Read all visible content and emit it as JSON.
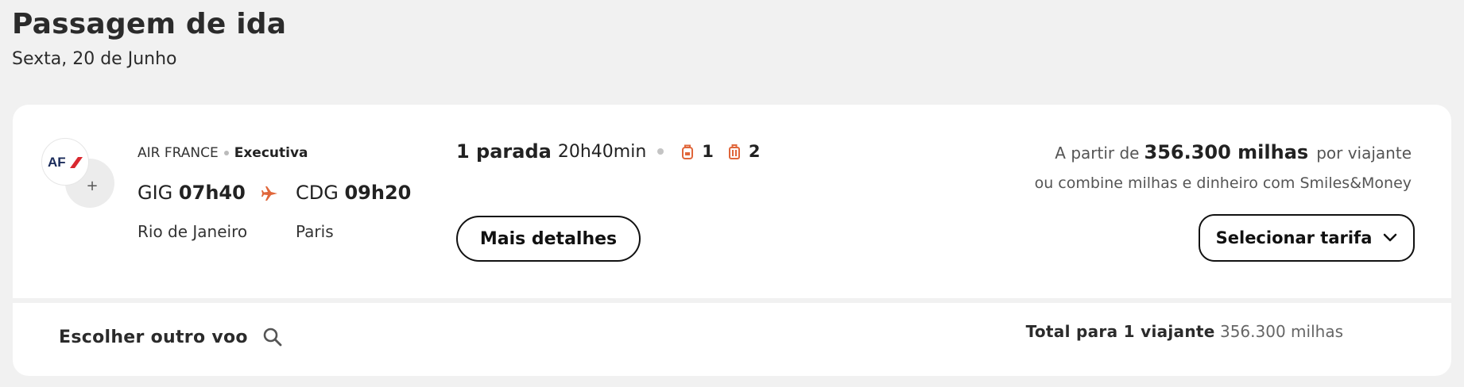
{
  "header": {
    "title": "Passagem de ida",
    "date": "Sexta, 20 de Junho"
  },
  "flight": {
    "airline": "AIR FRANCE",
    "cabin": "Executiva",
    "logo_text": "AF",
    "more_symbol": "+",
    "origin_code": "GIG",
    "departure_time": "07h40",
    "origin_city": "Rio de Janeiro",
    "destination_code": "CDG",
    "arrival_time": "09h20",
    "destination_city": "Paris",
    "stops": "1 parada",
    "duration": "20h40min",
    "carry_on_count": "1",
    "checked_bag_count": "2",
    "details_button": "Mais detalhes"
  },
  "price": {
    "prefix": "A partir de",
    "miles": "356.300 milhas",
    "suffix": "por viajante",
    "combine_text": "ou combine milhas e dinheiro com Smiles&Money",
    "select_button": "Selecionar tarifa"
  },
  "footer": {
    "other_flight_label": "Escolher outro voo",
    "total_label": "Total para 1 viajante",
    "total_value": "356.300 milhas"
  },
  "colors": {
    "accent": "#e0663a",
    "logo_blue": "#1a2b5a",
    "logo_red": "#d9282f"
  },
  "icons": {
    "plane": "plane-icon",
    "carry_on": "backpack-icon",
    "checked_bag": "suitcase-icon",
    "chevron": "chevron-down-icon",
    "search": "search-icon"
  }
}
